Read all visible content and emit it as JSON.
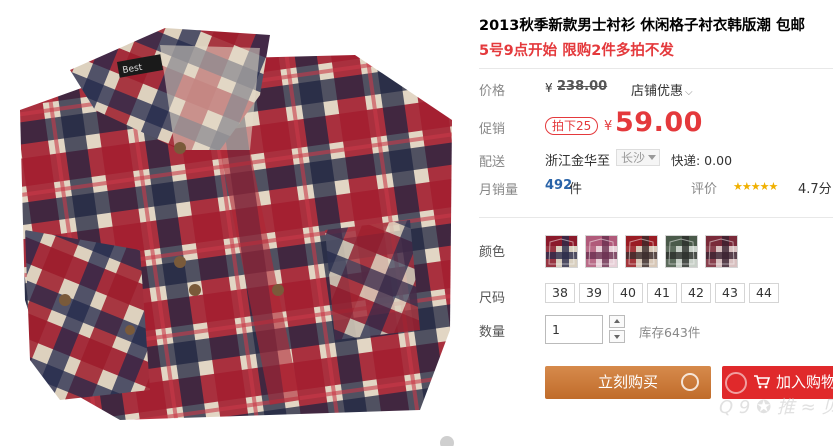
{
  "product": {
    "title": "2013秋季新款男士衬衫 休闲格子衬衣韩版潮 包邮",
    "subtitle": "5号9点开始 限购2件多拍不发",
    "brand_tag": "Best"
  },
  "price": {
    "label": "价格",
    "currency": "¥",
    "original": "238.00",
    "shop_discount": "店铺优惠",
    "promo_label": "促销",
    "badge": "拍下25",
    "promo_price": "59.00"
  },
  "shipping": {
    "label": "配送",
    "from": "浙江金华",
    "to_label": "至",
    "to_city": "长沙",
    "express": "快递: 0.00"
  },
  "sales": {
    "label": "月销量",
    "count": "492",
    "unit": "件",
    "rating_label": "评价",
    "stars": "★★★★★",
    "score": "4.7分",
    "rating_value": 4.7
  },
  "options": {
    "color_label": "颜色",
    "colors": [
      {
        "name": "navy-red",
        "c1": "#8b1a2b",
        "c2": "#2a2a4a",
        "c3": "#d9d0c0"
      },
      {
        "name": "pink",
        "c1": "#b05a7a",
        "c2": "#6a3050",
        "c3": "#e8d0d8"
      },
      {
        "name": "red-black",
        "c1": "#9a1c24",
        "c2": "#3a2a2a",
        "c3": "#d8c8b8"
      },
      {
        "name": "green-gray",
        "c1": "#4a5a4a",
        "c2": "#2a2e2a",
        "c3": "#c8d0c8"
      },
      {
        "name": "wine",
        "c1": "#7a2a3a",
        "c2": "#3a2030",
        "c3": "#d8c0c0"
      }
    ],
    "size_label": "尺码",
    "sizes": [
      "38",
      "39",
      "40",
      "41",
      "42",
      "43",
      "44"
    ]
  },
  "quantity": {
    "label": "数量",
    "value": "1",
    "stock": "库存643件"
  },
  "actions": {
    "buy_now": "立刻购买",
    "add_to_cart": "加入购物"
  },
  "watermark": "Q 9 ✪ 推 ≈ 贝"
}
